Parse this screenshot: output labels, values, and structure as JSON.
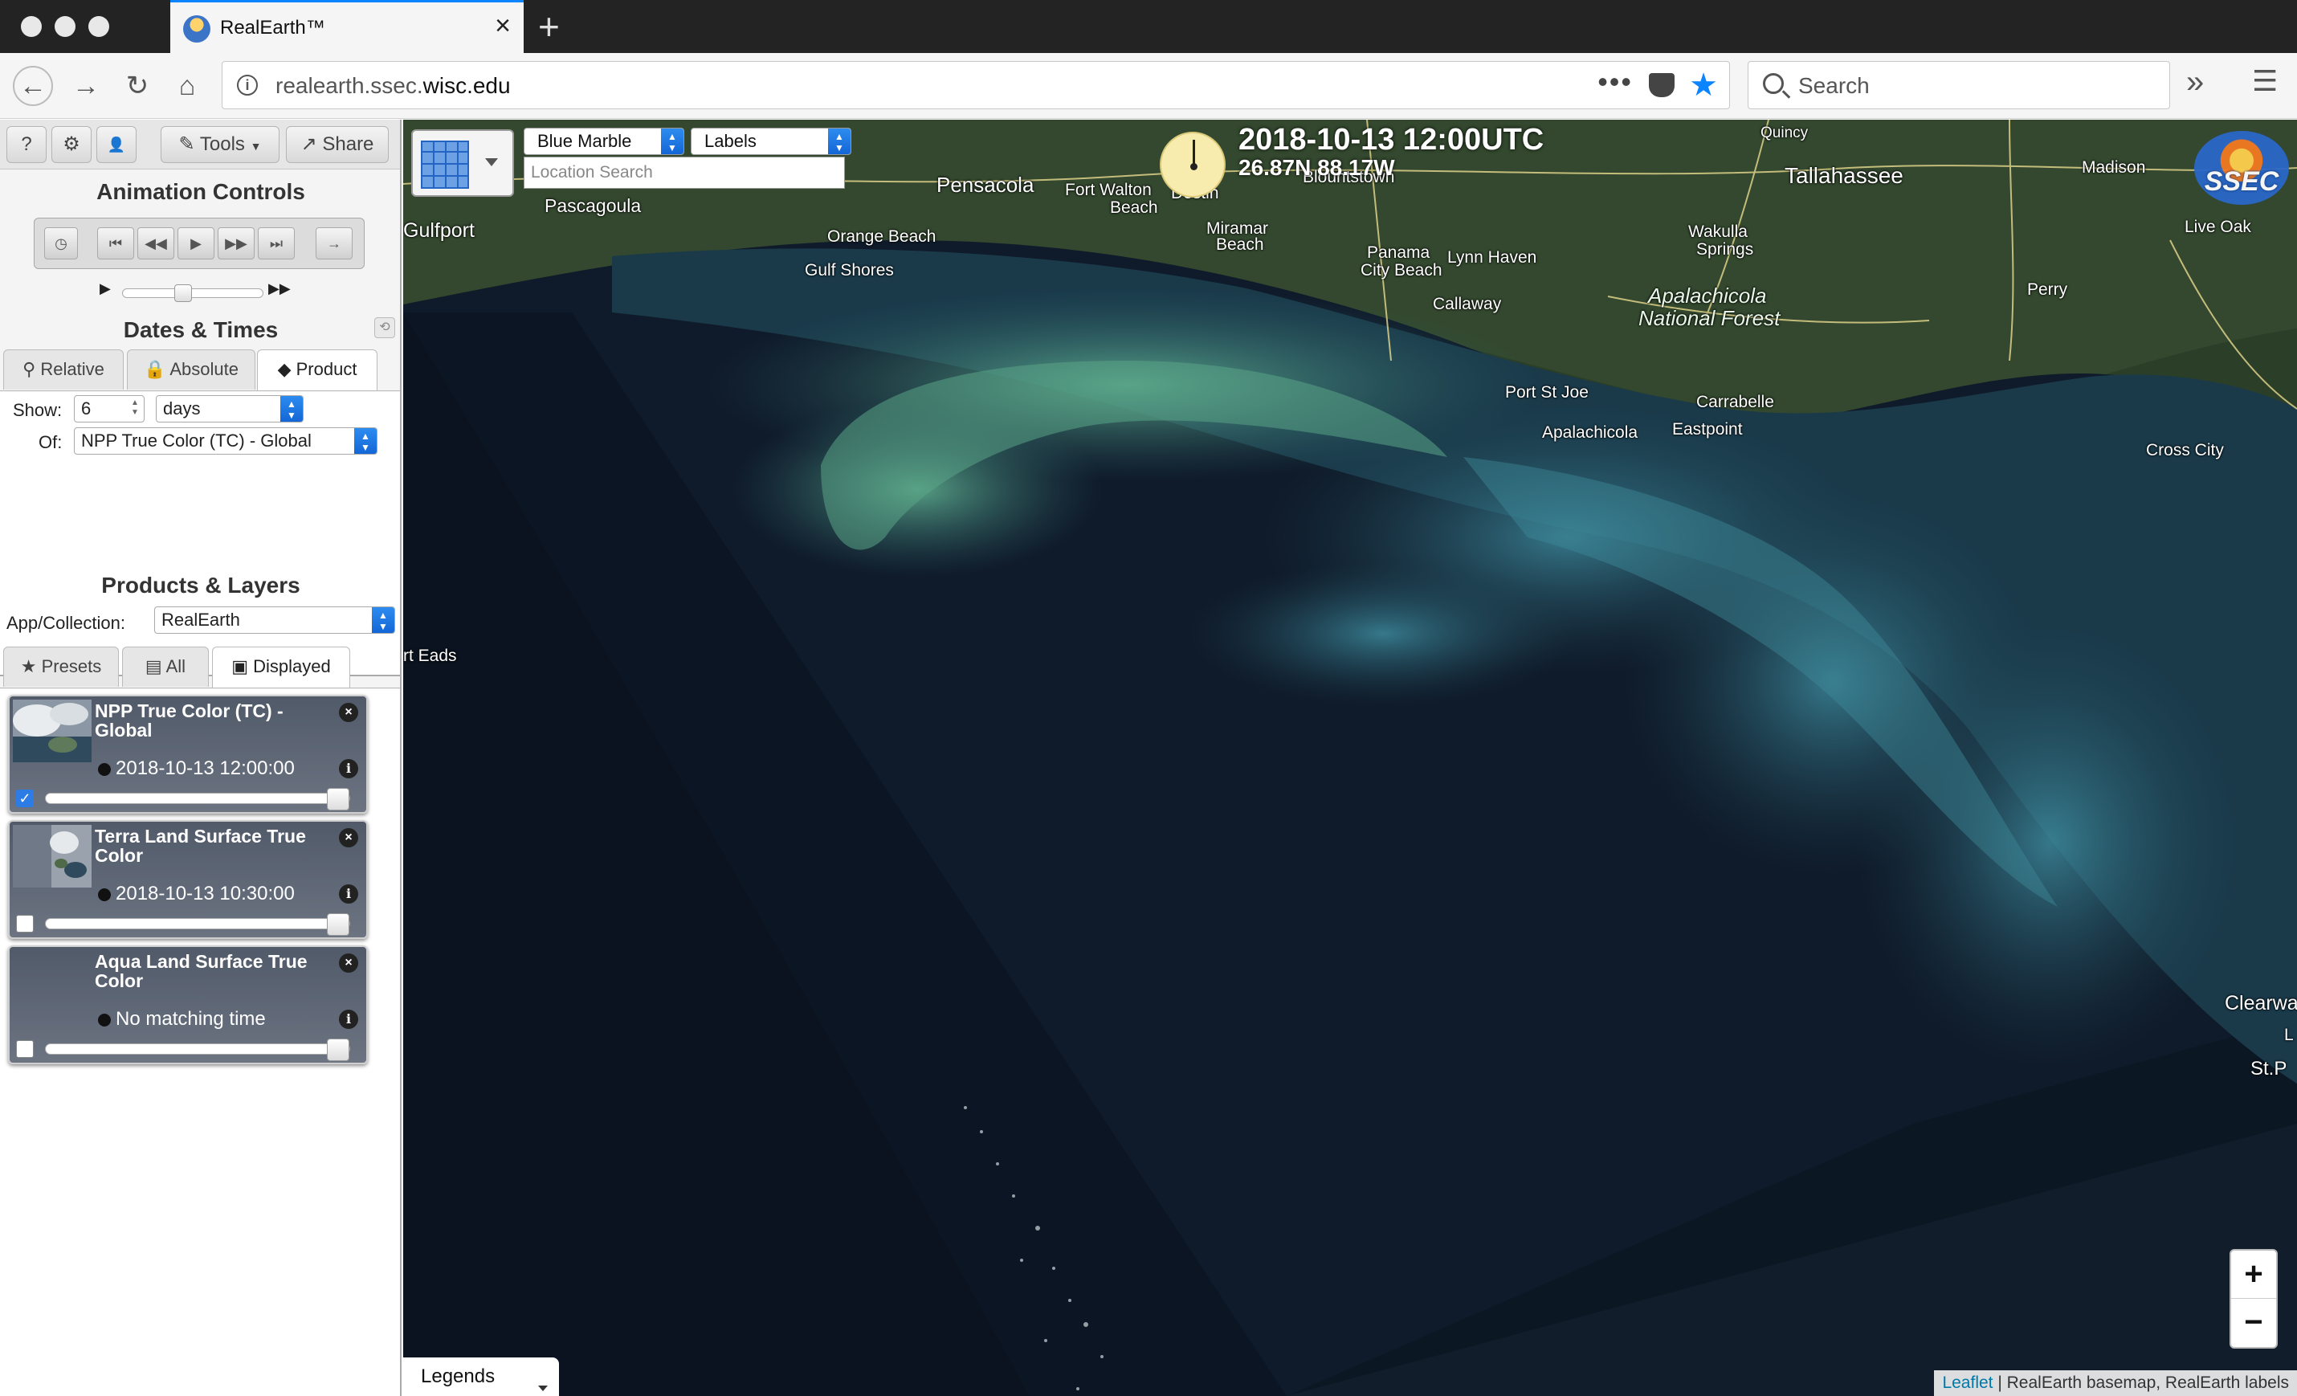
{
  "browser": {
    "tab_title": "RealEarth™",
    "url_host": "realearth.ssec.",
    "url_domain": "wisc.edu",
    "search_placeholder": "Search"
  },
  "toolbar": {
    "help_label": "?",
    "settings_label": "⚙",
    "user_label": "👤",
    "tools_label": "Tools",
    "share_label": "Share"
  },
  "animation": {
    "title": "Animation Controls",
    "speed_fraction": 0.42
  },
  "dates": {
    "title": "Dates & Times",
    "tabs": [
      "Relative",
      "Absolute",
      "Product"
    ],
    "active_tab": "Product",
    "show_label": "Show:",
    "show_value": "6",
    "unit_value": "days",
    "of_label": "Of:",
    "of_value": "NPP True Color (TC) - Global"
  },
  "products": {
    "title": "Products & Layers",
    "collection_label": "App/Collection:",
    "collection_value": "RealEarth",
    "tabs": [
      "Presets",
      "All",
      "Displayed"
    ],
    "active_tab": "Displayed",
    "layers": [
      {
        "title": "NPP True Color (TC) - Global",
        "time": "2018-10-13 12:00:00",
        "checked": true,
        "opacity": 1.0
      },
      {
        "title": "Terra Land Surface True Color",
        "time": "2018-10-13 10:30:00",
        "checked": false,
        "opacity": 1.0
      },
      {
        "title": "Aqua Land Surface True Color",
        "time": "No matching time",
        "checked": false,
        "opacity": 1.0
      }
    ]
  },
  "map": {
    "basemap": "Blue Marble",
    "overlay": "Labels",
    "location_placeholder": "Location Search",
    "timestamp": "2018-10-13 12:00UTC",
    "coords": "26.87N 88.17W",
    "logo_text": "SSEC",
    "legends_label": "Legends",
    "attribution_link": "Leaflet",
    "attribution_text": " | RealEarth basemap, RealEarth labels",
    "zoom_in": "+",
    "zoom_out": "−",
    "places": {
      "pensacola": "Pensacola",
      "fort_walton": "Fort Walton",
      "fort_walton_2": "Beach",
      "pascagoula": "Pascagoula",
      "gulfport": "Gulfport",
      "orange_beach": "Orange Beach",
      "gulf_shores": "Gulf Shores",
      "miramar": "Miramar",
      "miramar_2": "Beach",
      "destin": "Destin",
      "panama_city": "Panama",
      "panama_city_2": "City Beach",
      "lynn_haven": "Lynn Haven",
      "callaway": "Callaway",
      "blountstown": "Blountstown",
      "tallahassee": "Tallahassee",
      "quincy": "Quincy",
      "madison": "Madison",
      "live_oak": "Live Oak",
      "wakulla": "Wakulla",
      "wakulla_2": "Springs",
      "perry": "Perry",
      "apalachicola_nf": "Apalachicola",
      "apalachicola_nf_2": "National Forest",
      "port_st_joe": "Port St Joe",
      "carrabelle": "Carrabelle",
      "apalachicola": "Apalachicola",
      "eastpoint": "Eastpoint",
      "cross_city": "Cross City",
      "port_eads": "rt Eads",
      "clearwater": "Clearwa",
      "st_p": "St.P",
      "l_label": "L"
    }
  }
}
